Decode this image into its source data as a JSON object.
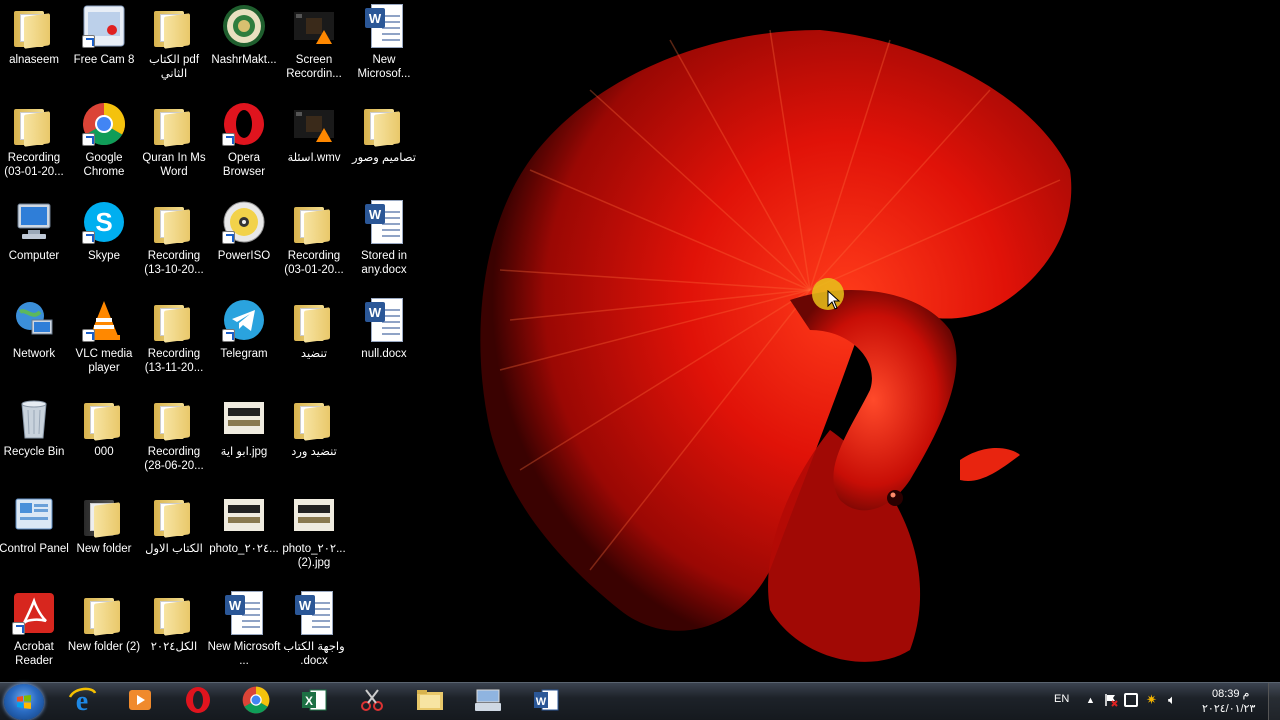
{
  "desktop": {
    "icons": [
      {
        "id": "alnaseem",
        "label": "alnaseem",
        "kind": "user-folder-icon"
      },
      {
        "id": "free-cam",
        "label": "Free Cam 8",
        "kind": "free-cam-icon"
      },
      {
        "id": "pdf-book",
        "label": "الكتاب pdf الثاني",
        "kind": "folder-icon"
      },
      {
        "id": "nashr",
        "label": "NashrMakt...",
        "kind": "seal-app-icon"
      },
      {
        "id": "screen-rec",
        "label": "Screen Recordin...",
        "kind": "video-file-icon"
      },
      {
        "id": "new-ms-1",
        "label": "New Microsof...",
        "kind": "word-doc-icon"
      },
      {
        "id": "recording-1",
        "label": "Recording (03-01-20...",
        "kind": "folder-icon"
      },
      {
        "id": "chrome",
        "label": "Google Chrome",
        "kind": "chrome-icon"
      },
      {
        "id": "quran",
        "label": "Quran In Ms Word",
        "kind": "folder-icon"
      },
      {
        "id": "opera",
        "label": "Opera Browser",
        "kind": "opera-icon"
      },
      {
        "id": "asila",
        "label": "اسئلة.wmv",
        "kind": "video-file-icon"
      },
      {
        "id": "tasamim",
        "label": "تصاميم وصور",
        "kind": "folder-icon"
      },
      {
        "id": "computer",
        "label": "Computer",
        "kind": "computer-icon"
      },
      {
        "id": "skype",
        "label": "Skype",
        "kind": "skype-icon"
      },
      {
        "id": "recording-2",
        "label": "Recording (13-10-20...",
        "kind": "folder-icon"
      },
      {
        "id": "poweriso",
        "label": "PowerISO",
        "kind": "poweriso-icon"
      },
      {
        "id": "recording-3",
        "label": "Recording (03-01-20...",
        "kind": "folder-icon"
      },
      {
        "id": "stored",
        "label": "Stored in any.docx",
        "kind": "word-doc-icon"
      },
      {
        "id": "network",
        "label": "Network",
        "kind": "network-icon"
      },
      {
        "id": "vlc",
        "label": "VLC media player",
        "kind": "vlc-icon"
      },
      {
        "id": "recording-4",
        "label": "Recording (13-11-20...",
        "kind": "folder-icon"
      },
      {
        "id": "telegram",
        "label": "Telegram",
        "kind": "telegram-icon"
      },
      {
        "id": "tansid",
        "label": "تنضيد",
        "kind": "folder-icon"
      },
      {
        "id": "null-docx",
        "label": "null.docx",
        "kind": "word-doc-icon"
      },
      {
        "id": "recycle",
        "label": "Recycle Bin",
        "kind": "recycle-bin-icon"
      },
      {
        "id": "f000",
        "label": "000",
        "kind": "folder-icon"
      },
      {
        "id": "recording-5",
        "label": "Recording (28-06-20...",
        "kind": "folder-icon"
      },
      {
        "id": "abu-aya",
        "label": "ابو اية.jpg",
        "kind": "image-file-icon"
      },
      {
        "id": "tansid-ward",
        "label": "تنضيد ورد",
        "kind": "folder-icon"
      },
      {
        "id": "control",
        "label": "Control Panel",
        "kind": "control-panel-icon"
      },
      {
        "id": "new-folder",
        "label": "New folder",
        "kind": "dark-folder-icon"
      },
      {
        "id": "kitab-awal",
        "label": "الكتاب الاول",
        "kind": "folder-icon"
      },
      {
        "id": "photo-1",
        "label": "photo_٢٠٢٤...",
        "kind": "image-file-icon"
      },
      {
        "id": "photo-2",
        "label": "photo_٢٠٢... (2).jpg",
        "kind": "image-file-icon"
      },
      {
        "id": "acrobat",
        "label": "Acrobat Reader",
        "kind": "acrobat-icon"
      },
      {
        "id": "new-folder-2",
        "label": "New folder (2)",
        "kind": "folder-icon"
      },
      {
        "id": "kul",
        "label": "الكل٢٠٢٤",
        "kind": "folder-icon"
      },
      {
        "id": "new-ms-2",
        "label": "New Microsoft ...",
        "kind": "word-doc-icon"
      },
      {
        "id": "wajiha",
        "label": "واجهة الكتاب .docx",
        "kind": "word-doc-icon"
      }
    ]
  },
  "taskbar": {
    "pinned": [
      {
        "id": "ie",
        "kind": "internet-explorer-icon"
      },
      {
        "id": "media",
        "kind": "media-player-icon"
      },
      {
        "id": "opera",
        "kind": "opera-icon"
      },
      {
        "id": "chrome",
        "kind": "chrome-icon"
      },
      {
        "id": "excel",
        "kind": "excel-icon"
      },
      {
        "id": "snip",
        "kind": "snipping-tool-icon"
      },
      {
        "id": "explorer",
        "kind": "file-explorer-icon"
      },
      {
        "id": "keyboard",
        "kind": "on-screen-keyboard-icon"
      },
      {
        "id": "word",
        "kind": "word-icon"
      }
    ],
    "tray": {
      "language": "EN",
      "time": "08:39 م",
      "date": "٢٠٢٤/٠١/٢٣"
    }
  },
  "colors": {
    "wallpaper_fish": "#e01208",
    "taskbar": "#1d2229",
    "cursor_highlight": "#e8c21a"
  }
}
